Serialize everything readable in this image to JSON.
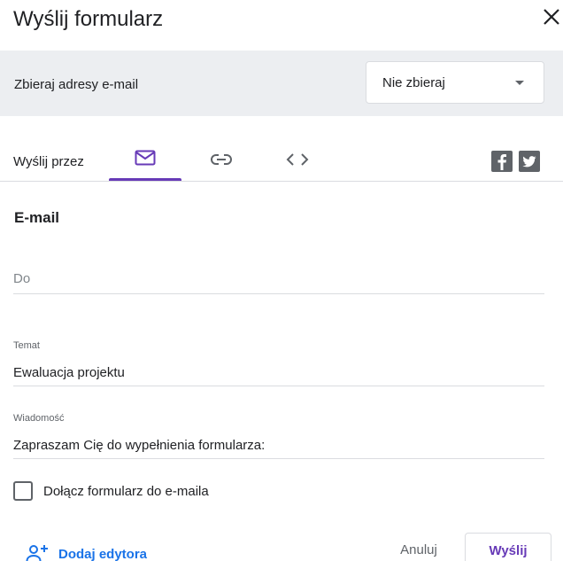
{
  "dialog": {
    "title": "Wyślij formularz",
    "close_icon": "close-icon"
  },
  "collect": {
    "label": "Zbieraj adresy e-mail",
    "selected": "Nie zbieraj"
  },
  "send_via": {
    "label": "Wyślij przez",
    "tabs": [
      {
        "name": "email",
        "icon": "mail-icon",
        "active": true
      },
      {
        "name": "link",
        "icon": "link-icon",
        "active": false
      },
      {
        "name": "embed",
        "icon": "code-icon",
        "active": false
      }
    ],
    "social": [
      "facebook-icon",
      "twitter-icon"
    ]
  },
  "email": {
    "section_title": "E-mail",
    "to_placeholder": "Do",
    "subject_label": "Temat",
    "subject_value": "Ewaluacja projektu",
    "message_label": "Wiadomość",
    "message_value": "Zapraszam Cię do wypełnienia formularza:",
    "include_label": "Dołącz formularz do e-maila",
    "include_checked": false
  },
  "footer": {
    "add_editor_label": "Dodaj edytora",
    "cancel_label": "Anuluj",
    "send_label": "Wyślij"
  },
  "colors": {
    "accent": "#673ab7",
    "link": "#1a73e8",
    "bar_bg": "#eceef1"
  }
}
